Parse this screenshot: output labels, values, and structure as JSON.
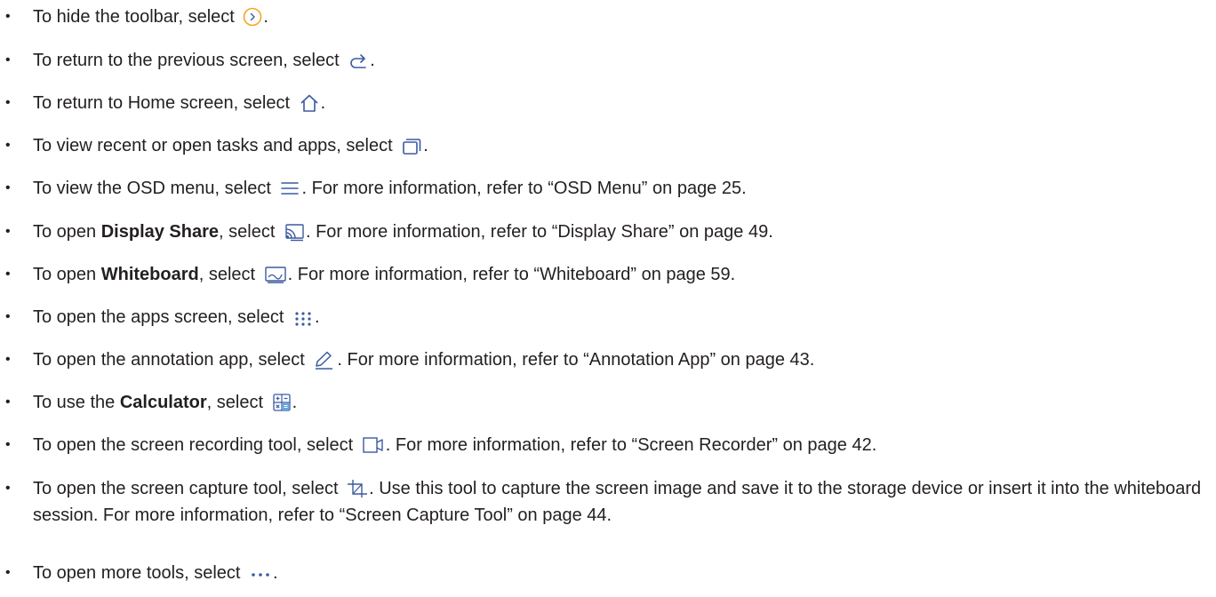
{
  "accent_color": "#3b5aa0",
  "icon_color": "#f5a623",
  "items": [
    {
      "pre": "To hide the toolbar, select ",
      "bold": "",
      "mid": "",
      "icon": "chevron-right-circle-icon",
      "post": "."
    },
    {
      "pre": "To return to the previous screen, select ",
      "bold": "",
      "mid": "",
      "icon": "back-arrow-icon",
      "post": "."
    },
    {
      "pre": "To return to Home screen, select ",
      "bold": "",
      "mid": "",
      "icon": "home-icon",
      "post": "."
    },
    {
      "pre": "To view recent or open tasks and apps, select ",
      "bold": "",
      "mid": "",
      "icon": "recent-tasks-icon",
      "post": "."
    },
    {
      "pre": "To view the OSD menu, select ",
      "bold": "",
      "mid": "",
      "icon": "menu-icon",
      "post": ". For more information, refer to “OSD Menu” on page 25."
    },
    {
      "pre": "To open ",
      "bold": "Display Share",
      "mid": ", select ",
      "icon": "display-share-icon",
      "post": ". For more information, refer to “Display Share” on page 49."
    },
    {
      "pre": "To open ",
      "bold": "Whiteboard",
      "mid": ", select ",
      "icon": "whiteboard-icon",
      "post": ". For more information, refer to “Whiteboard” on page 59."
    },
    {
      "pre": "To open the apps screen, select ",
      "bold": "",
      "mid": "",
      "icon": "apps-grid-icon",
      "post": "."
    },
    {
      "pre": "To open the annotation app, select ",
      "bold": "",
      "mid": "",
      "icon": "pen-icon",
      "post": ". For more information, refer to “Annotation App” on page 43."
    },
    {
      "pre": "To use the ",
      "bold": "Calculator",
      "mid": ", select ",
      "icon": "calculator-icon",
      "post": "."
    },
    {
      "pre": "To open the screen recording tool, select ",
      "bold": "",
      "mid": "",
      "icon": "screen-record-icon",
      "post": ". For more information, refer to “Screen Recorder” on page 42."
    },
    {
      "pre": "To open the screen capture tool, select ",
      "bold": "",
      "mid": "",
      "icon": "screen-capture-icon",
      "post": ". Use this tool to capture the screen image and save it to the storage device or insert it into the whiteboard session. For more information, refer to “Screen Capture Tool” on page 44."
    },
    {
      "pre": "To open more tools, select ",
      "bold": "",
      "mid": "",
      "icon": "more-icon",
      "post": "."
    }
  ]
}
